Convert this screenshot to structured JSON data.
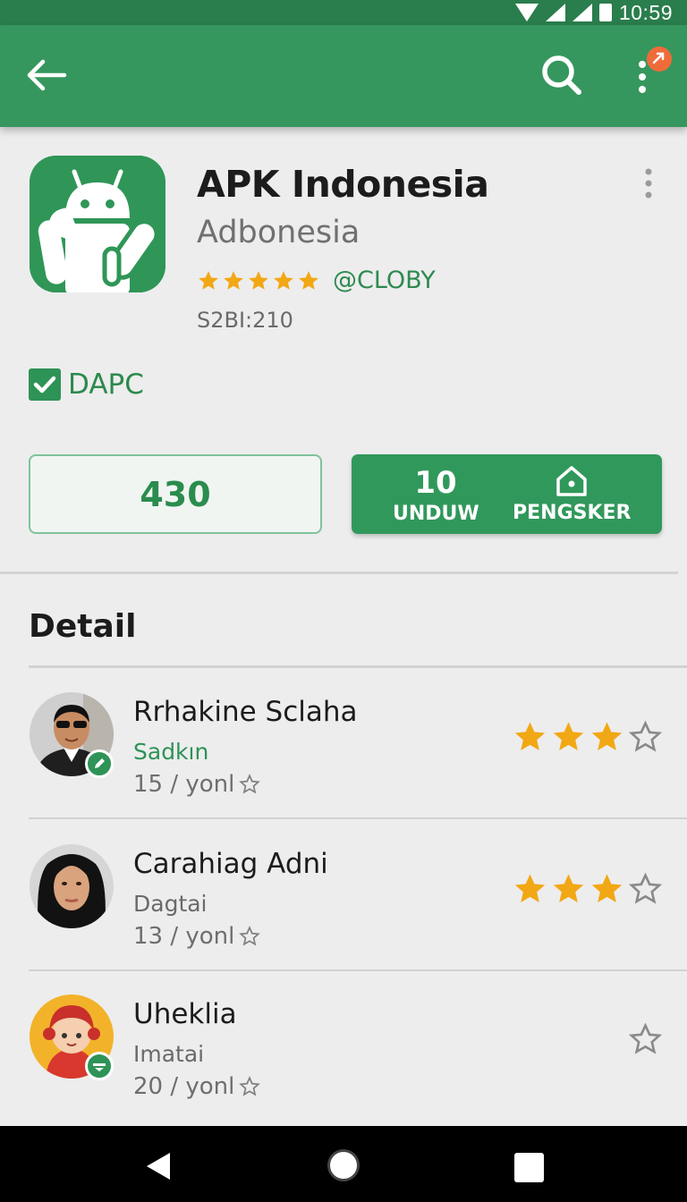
{
  "status_bar": {
    "time": "10:59"
  },
  "app_bar": {
    "back_icon": "arrow-left-icon",
    "search_icon": "search-icon",
    "more_icon": "more-vert-icon"
  },
  "app": {
    "name": "APK Indonesia",
    "developer": "Adbonesia",
    "rating_stars": 5,
    "handle": "@CLOBY",
    "meta": "S2BI:210",
    "checkbox_label": "DAPC",
    "checkbox_checked": true
  },
  "actions": {
    "count": "430",
    "download_count": "10",
    "download_label": "UNDUW",
    "home_label": "PENGSKER"
  },
  "section_title": "Detail",
  "reviews": [
    {
      "name": "Rrhakine Sclaha",
      "role": "Sadkın",
      "date": "15 / yonl",
      "stars": 3,
      "role_color": "#2e9356"
    },
    {
      "name": "Carahiag Adni",
      "role": "Dagtai",
      "date": "13 / yonl",
      "stars": 3,
      "role_color": "#6a6a6a"
    },
    {
      "name": "Uheklia",
      "role": "Imatai",
      "date": "20 / yonl",
      "stars": 0,
      "role_color": "#6a6a6a"
    }
  ],
  "colors": {
    "primary": "#35975d",
    "primary_dark": "#2a7d4c",
    "star": "#f2a814",
    "badge": "#ef6b3a"
  }
}
